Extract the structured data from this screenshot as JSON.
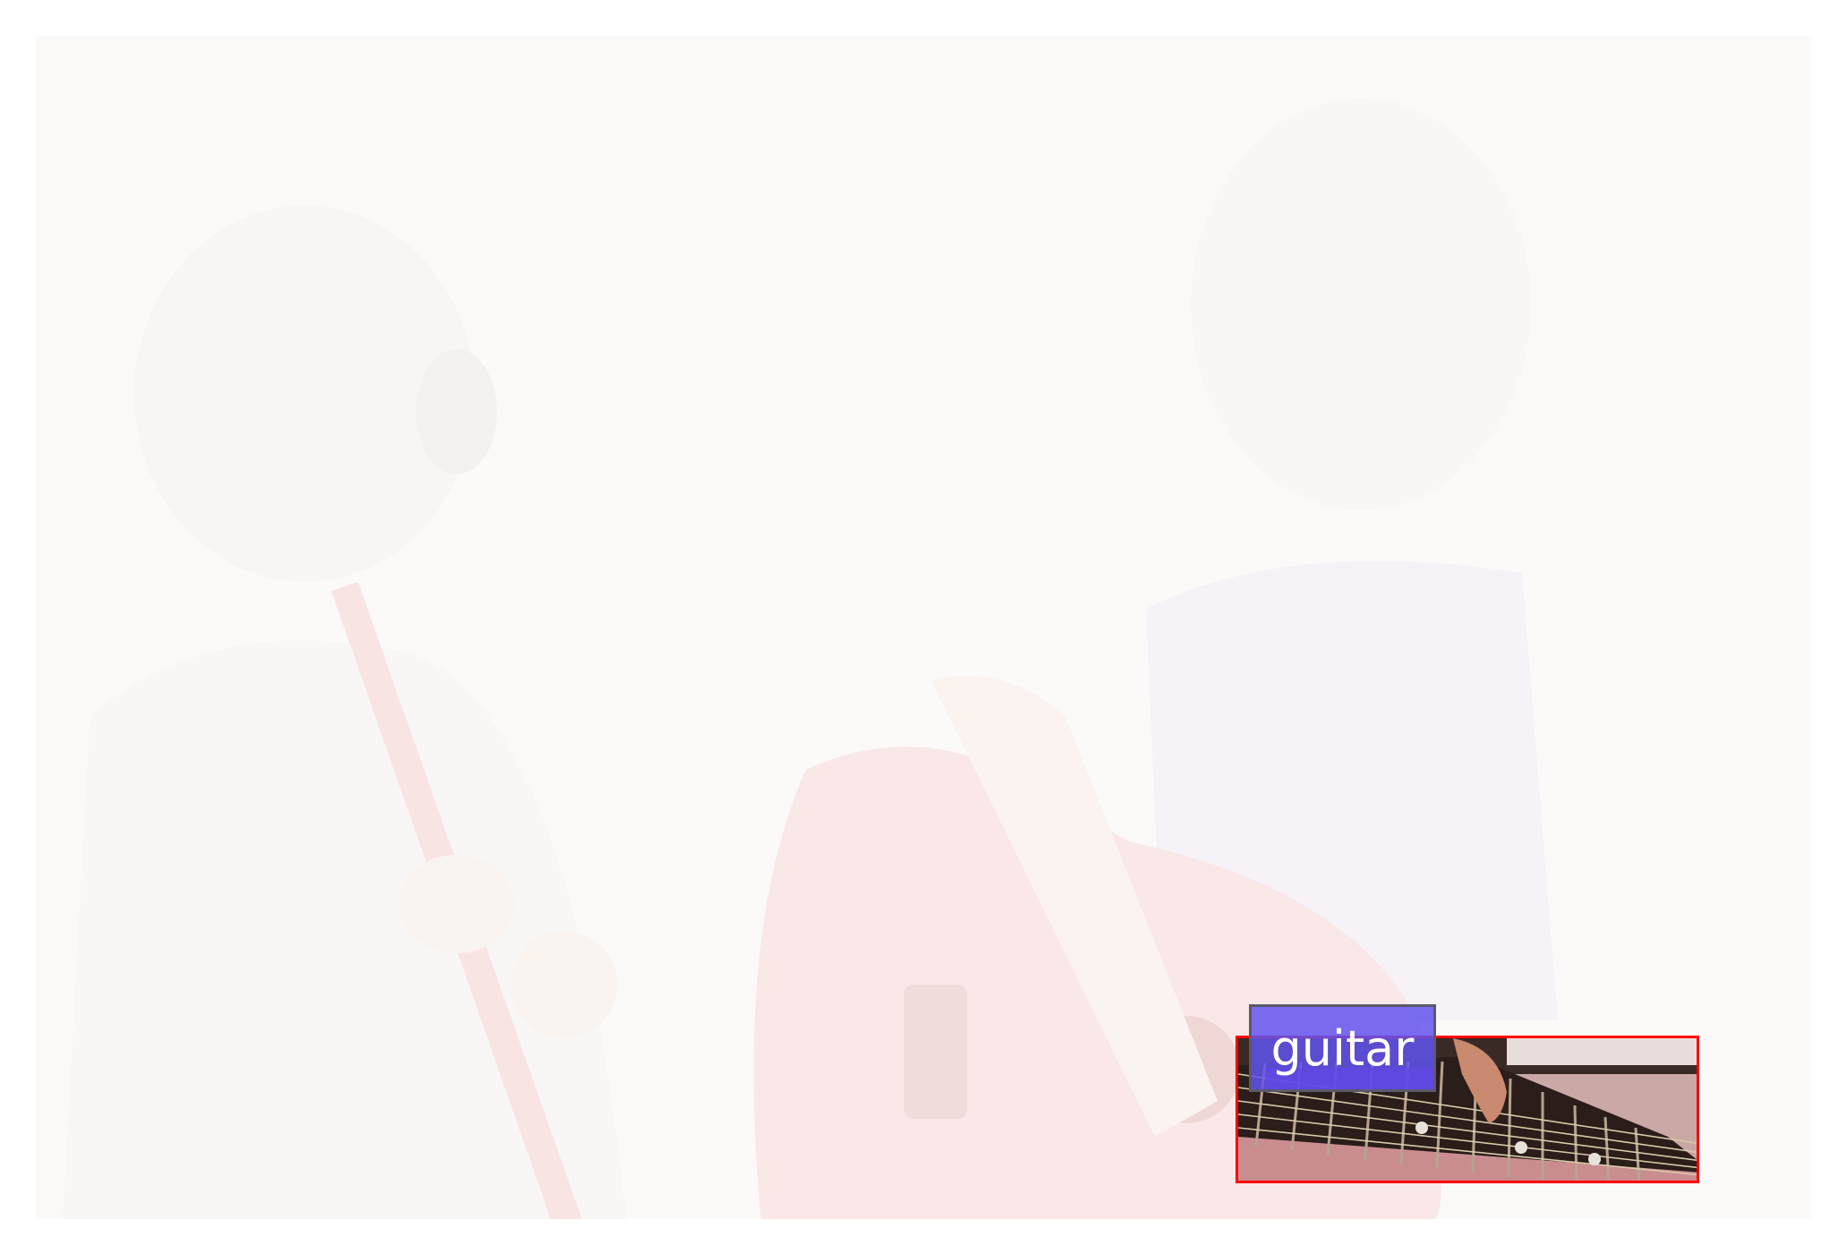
{
  "annotation": {
    "label": "guitar",
    "box_color": "#ff0000",
    "label_color": "#6254ee"
  }
}
